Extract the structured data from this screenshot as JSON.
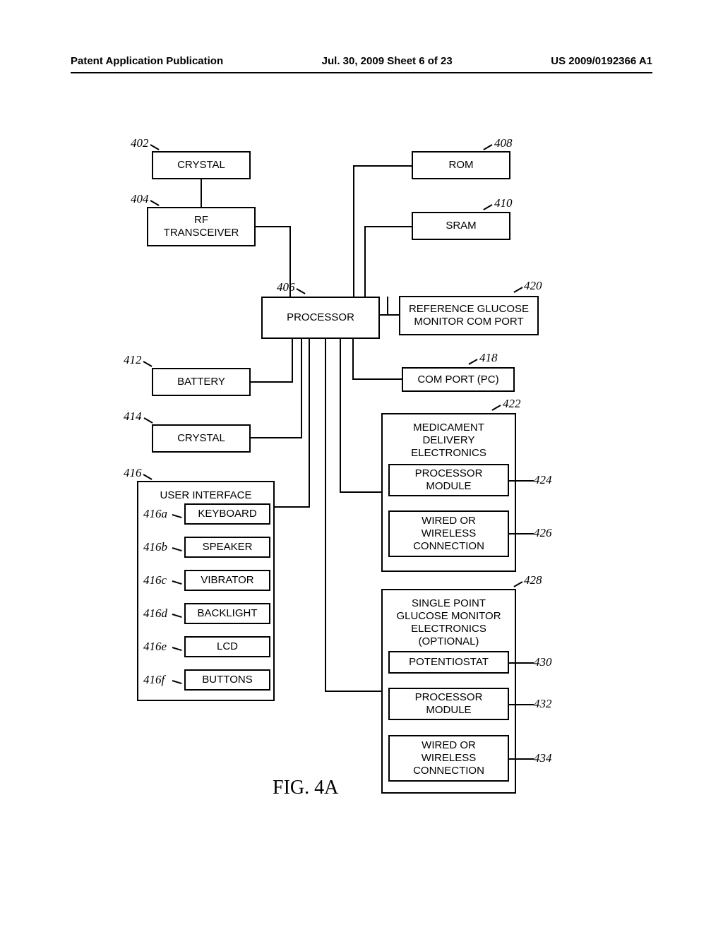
{
  "header": {
    "left": "Patent Application Publication",
    "mid": "Jul. 30, 2009  Sheet 6 of 23",
    "right": "US 2009/0192366 A1"
  },
  "figure": "FIG. 4A",
  "blocks": {
    "crystal1": "CRYSTAL",
    "rf": "RF\nTRANSCEIVER",
    "processor": "PROCESSOR",
    "battery": "BATTERY",
    "crystal2": "CRYSTAL",
    "ui_title": "USER INTERFACE",
    "keyboard": "KEYBOARD",
    "speaker": "SPEAKER",
    "vibrator": "VIBRATOR",
    "backlight": "BACKLIGHT",
    "lcd": "LCD",
    "buttons": "BUTTONS",
    "rom": "ROM",
    "sram": "SRAM",
    "refgluc": "REFERENCE GLUCOSE MONITOR COM PORT",
    "comport": "COM PORT (PC)",
    "med_title": "MEDICAMENT\nDELIVERY\nELECTRONICS",
    "procmod1": "PROCESSOR\nMODULE",
    "conn1": "WIRED OR\nWIRELESS\nCONNECTION",
    "sp_title": "SINGLE POINT\nGLUCOSE MONITOR\nELECTRONICS\n(OPTIONAL)",
    "potent": "POTENTIOSTAT",
    "procmod2": "PROCESSOR\nMODULE",
    "conn2": "WIRED OR\nWIRELESS\nCONNECTION"
  },
  "refs": {
    "r402": "402",
    "r404": "404",
    "r406": "406",
    "r408": "408",
    "r410": "410",
    "r412": "412",
    "r414": "414",
    "r416": "416",
    "r416a": "416a",
    "r416b": "416b",
    "r416c": "416c",
    "r416d": "416d",
    "r416e": "416e",
    "r416f": "416f",
    "r418": "418",
    "r420": "420",
    "r422": "422",
    "r424": "424",
    "r426": "426",
    "r428": "428",
    "r430": "430",
    "r432": "432",
    "r434": "434"
  }
}
